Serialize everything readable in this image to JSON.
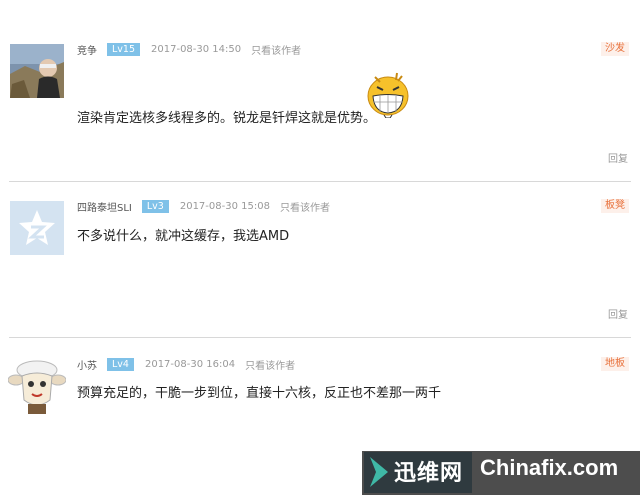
{
  "comments": [
    {
      "name": "竞争",
      "level": "Lv15",
      "time": "2017-08-30 14:50",
      "only_author": "只看该作者",
      "floor": "沙发",
      "content": "渲染肯定选核多线程多的。锐龙是钎焊这就是优势。",
      "reply": "回复",
      "avatar_icon": "photo-elderly-man-avatar",
      "emoji_icon": "grinning-face-emoji"
    },
    {
      "name": "四路泰坦SLI",
      "level": "Lv3",
      "time": "2017-08-30 15:08",
      "only_author": "只看该作者",
      "floor": "板凳",
      "content": "不多说什么，就冲这缓存，我选AMD",
      "reply": "回复",
      "avatar_icon": "qzone-star-avatar"
    },
    {
      "name": "小苏",
      "level": "Lv4",
      "time": "2017-08-30 16:04",
      "only_author": "只看该作者",
      "floor": "地板",
      "content": "预算充足的，干脆一步到位，直接十六核，反正也不差那一两千",
      "avatar_icon": "cartoon-sheep-avatar"
    }
  ],
  "watermark": {
    "brand_cn": "迅维网",
    "brand_en": "Chinafix.com"
  },
  "colors": {
    "level_badge": "#7fc1e8",
    "floor_text": "#e8703a",
    "divider": "#d8d8d8"
  }
}
